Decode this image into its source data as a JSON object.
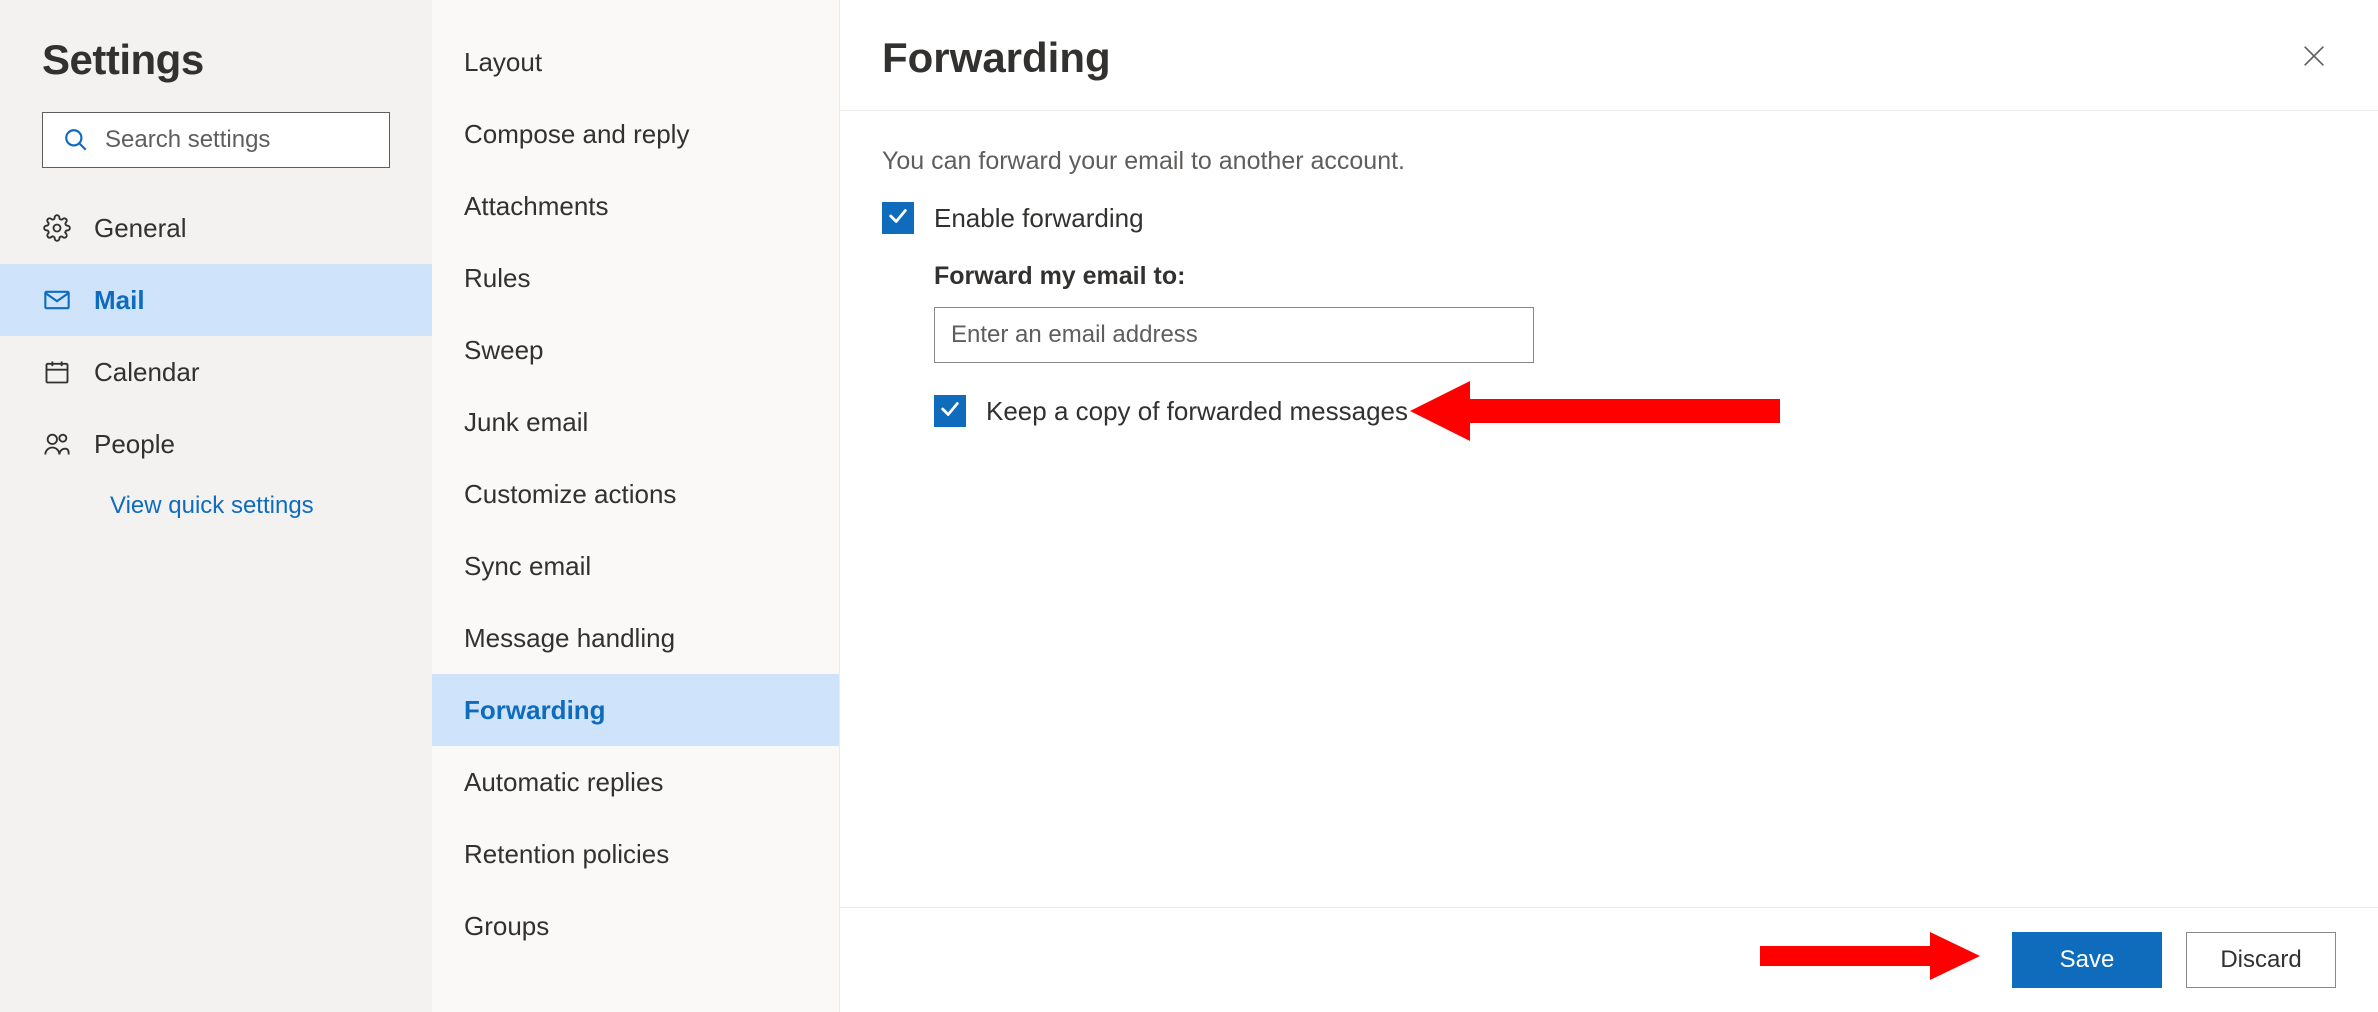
{
  "sidebar": {
    "title": "Settings",
    "search_placeholder": "Search settings",
    "nav": [
      {
        "id": "general",
        "label": "General"
      },
      {
        "id": "mail",
        "label": "Mail"
      },
      {
        "id": "calendar",
        "label": "Calendar"
      },
      {
        "id": "people",
        "label": "People"
      }
    ],
    "active_nav": "mail",
    "quick_link": "View quick settings"
  },
  "sublist": {
    "items": [
      "Layout",
      "Compose and reply",
      "Attachments",
      "Rules",
      "Sweep",
      "Junk email",
      "Customize actions",
      "Sync email",
      "Message handling",
      "Forwarding",
      "Automatic replies",
      "Retention policies",
      "Groups"
    ],
    "active": "Forwarding"
  },
  "main": {
    "title": "Forwarding",
    "description": "You can forward your email to another account.",
    "enable_label": "Enable forwarding",
    "enable_checked": true,
    "forward_to_label": "Forward my email to:",
    "forward_to_placeholder": "Enter an email address",
    "forward_to_value": "",
    "keep_copy_label": "Keep a copy of forwarded messages",
    "keep_copy_checked": true,
    "save_label": "Save",
    "discard_label": "Discard"
  },
  "colors": {
    "accent": "#0f6cbd",
    "selection_bg": "#cfe4fa",
    "annotation": "#ff0000"
  }
}
